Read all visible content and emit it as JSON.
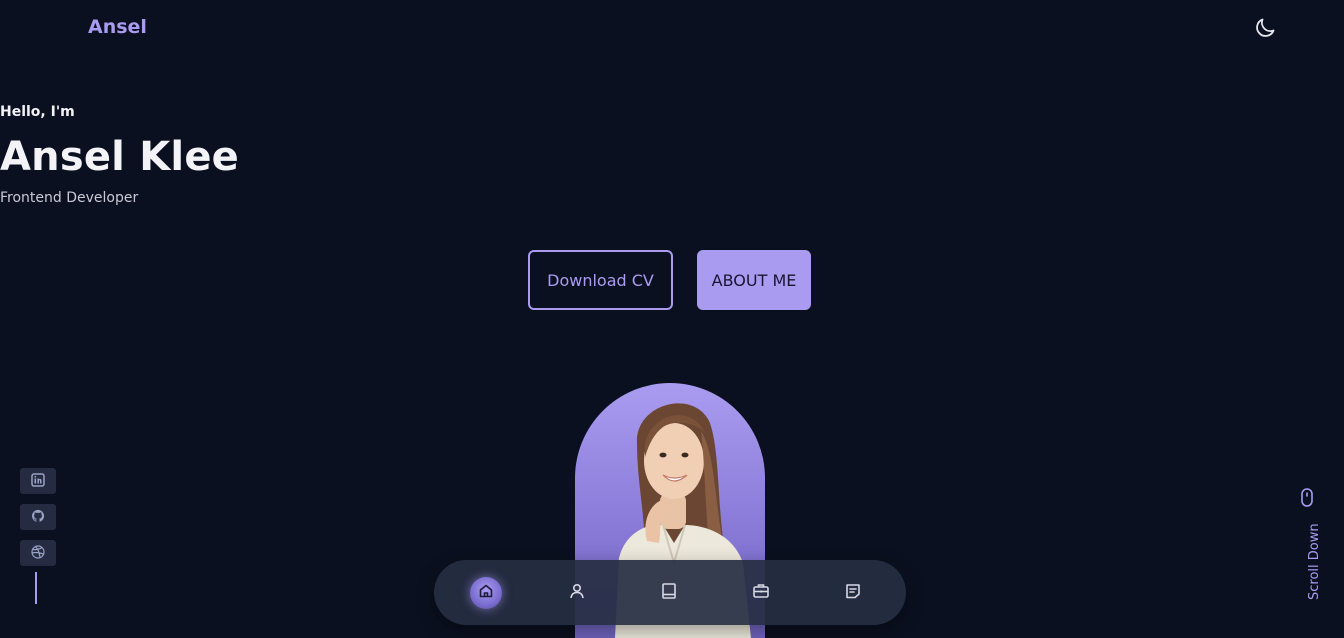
{
  "header": {
    "logo": "Ansel",
    "theme_icon": "moon-icon"
  },
  "hero": {
    "greeting": "Hello, I'm",
    "name": "Ansel Klee",
    "role": "Frontend Developer",
    "download_label": "Download CV",
    "about_label": "ABOUT ME"
  },
  "social": [
    {
      "icon": "linkedin-icon"
    },
    {
      "icon": "github-icon"
    },
    {
      "icon": "dribbble-icon"
    }
  ],
  "scroll": {
    "label": "Scroll Down",
    "icon": "mouse-icon"
  },
  "bottom_nav": [
    {
      "icon": "home-icon",
      "active": true
    },
    {
      "icon": "user-icon",
      "active": false
    },
    {
      "icon": "book-icon",
      "active": false
    },
    {
      "icon": "briefcase-icon",
      "active": false
    },
    {
      "icon": "message-icon",
      "active": false
    }
  ],
  "colors": {
    "background": "#0b1020",
    "accent": "#a99cf0",
    "text": "#f3f3f8",
    "muted": "#c9c9d6"
  }
}
